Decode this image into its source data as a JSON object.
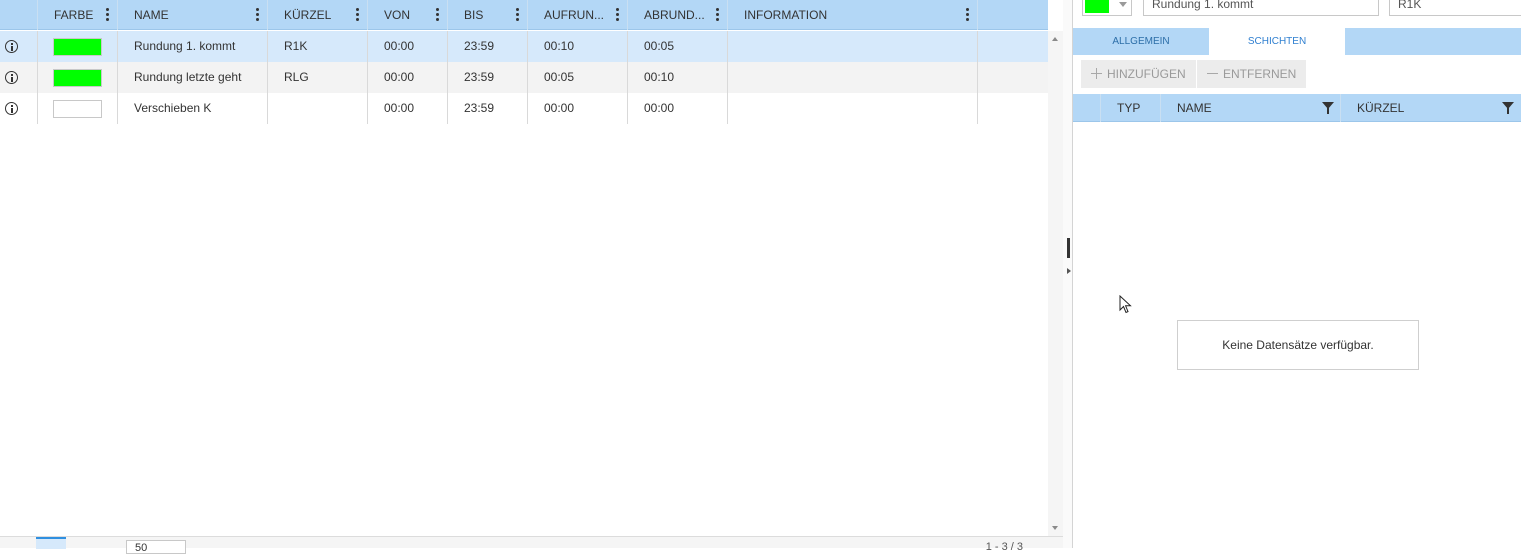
{
  "grid": {
    "columns": [
      "",
      "FARBE",
      "NAME",
      "KÜRZEL",
      "VON",
      "BIS",
      "AUFRUN...",
      "ABRUND...",
      "INFORMATION"
    ],
    "rows": [
      {
        "color": "#00ff00",
        "name": "Rundung 1. kommt",
        "abbr": "R1K",
        "from": "00:00",
        "to": "23:59",
        "up": "00:10",
        "down": "00:05",
        "info": ""
      },
      {
        "color": "#00ff00",
        "name": "Rundung letzte geht",
        "abbr": "RLG",
        "from": "00:00",
        "to": "23:59",
        "up": "00:05",
        "down": "00:10",
        "info": ""
      },
      {
        "color": "#ffffff",
        "name": "Verschieben K",
        "abbr": "",
        "from": "00:00",
        "to": "23:59",
        "up": "00:00",
        "down": "00:00",
        "info": ""
      }
    ]
  },
  "pager": {
    "page_size": "50",
    "info": "1 - 3 / 3"
  },
  "detail": {
    "color": "#00ff00",
    "name_value": "Rundung 1. kommt",
    "abbr_value": "R1K",
    "tabs": [
      "ALLGEMEIN",
      "SCHICHTEN"
    ],
    "active_tab": "SCHICHTEN",
    "add_label": "HINZUFÜGEN",
    "remove_label": "ENTFERNEN",
    "columns": [
      "TYP",
      "NAME",
      "KÜRZEL"
    ],
    "empty_message": "Keine Datensätze verfügbar."
  },
  "colors": {
    "header_bg": "#b3d7f6",
    "selected_row": "#d6e9fb",
    "accent": "#2f7fd0"
  },
  "icons": [
    "info-icon",
    "kebab-menu-icon",
    "filter-icon",
    "plus-icon",
    "minus-icon",
    "dropdown-arrow-icon",
    "mouse-cursor-icon"
  ]
}
